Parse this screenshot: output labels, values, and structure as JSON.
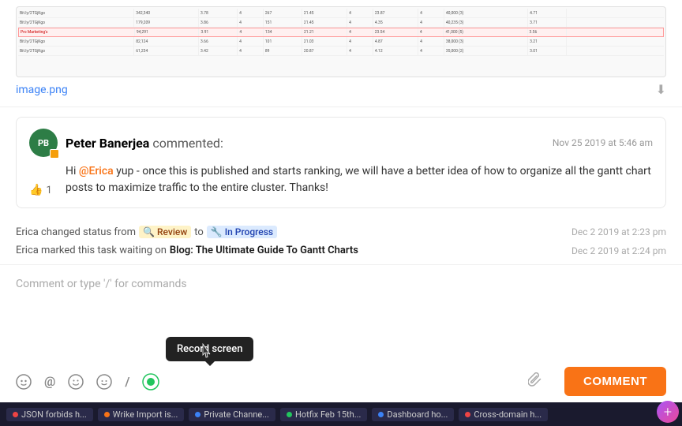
{
  "image": {
    "filename": "image.png",
    "download_label": "⬇",
    "rows": [
      {
        "cells": [
          "Bit.ly/2TGjKgo",
          "342,340",
          "3.78",
          "4",
          "267",
          "21.45",
          "4",
          "23.87",
          "4",
          "40,000 (3)",
          "4.71"
        ]
      },
      {
        "cells": [
          "Bit.ly/2TGjKgo",
          "179,209",
          "3.86",
          "4",
          "151",
          "21.45",
          "4",
          "4.35",
          "4",
          "40,235 (3)",
          "3.71"
        ],
        "highlight": false
      },
      {
        "cells": [
          "Pro Marketing's",
          "94,291",
          "3.91",
          "4",
          "134",
          "21.21",
          "4",
          "23.54",
          "4",
          "41,000 (5)",
          "3.56"
        ],
        "highlight": true
      },
      {
        "cells": [
          "Bit.ly/2TGjKgo",
          "82,124",
          "3.66",
          "4",
          "101",
          "21.03",
          "4",
          "4.87",
          "4",
          "38,000 (3)",
          "3.21"
        ]
      },
      {
        "cells": [
          "Bit.ly/2TGjKgo",
          "61,234",
          "3.42",
          "4",
          "89",
          "20.87",
          "4",
          "4.12",
          "4",
          "35,000 (2)",
          "3.01"
        ]
      }
    ]
  },
  "comment": {
    "author_initials": "PB",
    "author_name": "Peter Banerjea",
    "commented_label": "commented:",
    "timestamp": "Nov 25 2019 at 5:46 am",
    "text_part1": "Hi",
    "mention": "@Erica",
    "text_part2": "yup - once this is published and starts ranking, we will have a better idea of how to organize all the gantt chart posts to maximize traffic to the entire cluster. Thanks!",
    "likes": "1"
  },
  "activity": [
    {
      "text_before": "Erica changed status from",
      "from_status": "Review",
      "from_icon": "🔍",
      "from_color": "yellow",
      "to_label": "to",
      "to_status": "In Progress",
      "to_icon": "🔧",
      "to_color": "blue",
      "timestamp": "Dec 2 2019 at 2:23 pm"
    },
    {
      "text_before": "Erica marked this task waiting on",
      "bold_text": "Blog: The Ultimate Guide To Gantt Charts",
      "timestamp": "Dec 2 2019 at 2:24 pm"
    }
  ],
  "comment_input": {
    "placeholder": "Comment or type '/' for commands"
  },
  "toolbar": {
    "icons": [
      {
        "name": "emoji-person-icon",
        "symbol": "😊",
        "label": "emoji person"
      },
      {
        "name": "mention-icon",
        "symbol": "@",
        "label": "mention"
      },
      {
        "name": "emoji-icon",
        "symbol": "😄",
        "label": "emoji"
      },
      {
        "name": "reaction-icon",
        "symbol": "🙂",
        "label": "reaction"
      },
      {
        "name": "slash-icon",
        "symbol": "/",
        "label": "commands"
      },
      {
        "name": "record-icon",
        "symbol": "⏺",
        "label": "record screen",
        "active": true
      }
    ],
    "record_tooltip": "Record screen",
    "attachment_icon": "📎",
    "comment_button": "COMMENT"
  },
  "taskbar": {
    "items": [
      {
        "label": "JSON forbids h...",
        "dot_color": "red"
      },
      {
        "label": "Wrike Import is...",
        "dot_color": "orange"
      },
      {
        "label": "Private Channe...",
        "dot_color": "blue"
      },
      {
        "label": "Hotfix Feb 15th...",
        "dot_color": "green"
      },
      {
        "label": "Dashboard ho...",
        "dot_color": "blue"
      },
      {
        "label": "Cross-domain h...",
        "dot_color": "red"
      }
    ]
  },
  "fab": {
    "symbol": "+"
  }
}
